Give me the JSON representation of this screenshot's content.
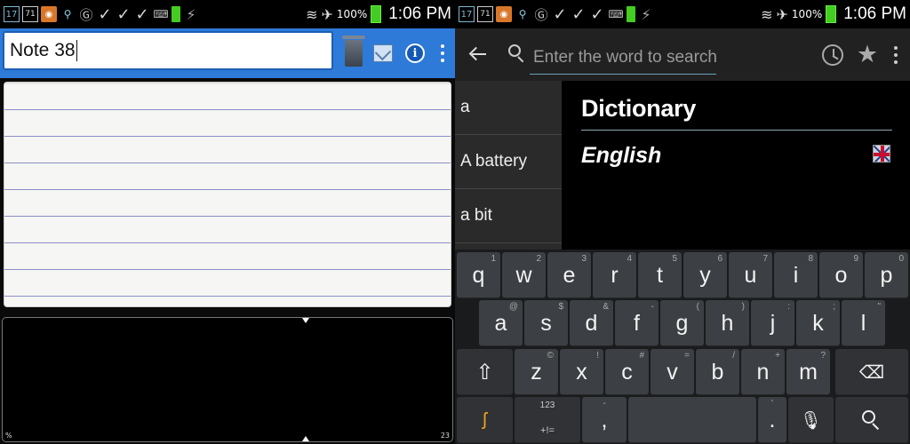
{
  "status_left": {
    "time": "1:06 PM",
    "battery": "100%",
    "calendar_day": "17",
    "badge": "71"
  },
  "status_right": {
    "time": "1:06 PM",
    "battery": "100%",
    "calendar_day": "17",
    "badge": "71"
  },
  "notepad": {
    "title_value": "Note 38",
    "corner_left": "%",
    "corner_right": "23"
  },
  "dictionary": {
    "search_placeholder": "Enter the word to search for",
    "words": [
      "a",
      "A battery",
      "a bit"
    ],
    "heading": "Dictionary",
    "language": "English"
  },
  "keyboard": {
    "row1": [
      {
        "k": "q",
        "h": "1"
      },
      {
        "k": "w",
        "h": "2"
      },
      {
        "k": "e",
        "h": "3"
      },
      {
        "k": "r",
        "h": "4"
      },
      {
        "k": "t",
        "h": "5"
      },
      {
        "k": "y",
        "h": "6"
      },
      {
        "k": "u",
        "h": "7"
      },
      {
        "k": "i",
        "h": "8"
      },
      {
        "k": "o",
        "h": "9"
      },
      {
        "k": "p",
        "h": "0"
      }
    ],
    "row2": [
      {
        "k": "a",
        "h": "@"
      },
      {
        "k": "s",
        "h": "$"
      },
      {
        "k": "d",
        "h": "&"
      },
      {
        "k": "f",
        "h": "-"
      },
      {
        "k": "g",
        "h": "("
      },
      {
        "k": "h",
        "h": ")"
      },
      {
        "k": "j",
        "h": ":"
      },
      {
        "k": "k",
        "h": ";"
      },
      {
        "k": "l",
        "h": "\""
      }
    ],
    "row3": [
      {
        "k": "z",
        "h": "©"
      },
      {
        "k": "x",
        "h": "!"
      },
      {
        "k": "c",
        "h": "#"
      },
      {
        "k": "v",
        "h": "="
      },
      {
        "k": "b",
        "h": "/"
      },
      {
        "k": "n",
        "h": "+"
      },
      {
        "k": "m",
        "h": "?"
      }
    ],
    "sym_top": "123",
    "sym_bottom": "+!=",
    "comma": ",",
    "comma_hint": "-",
    "period": ".",
    "period_hint": "'"
  }
}
